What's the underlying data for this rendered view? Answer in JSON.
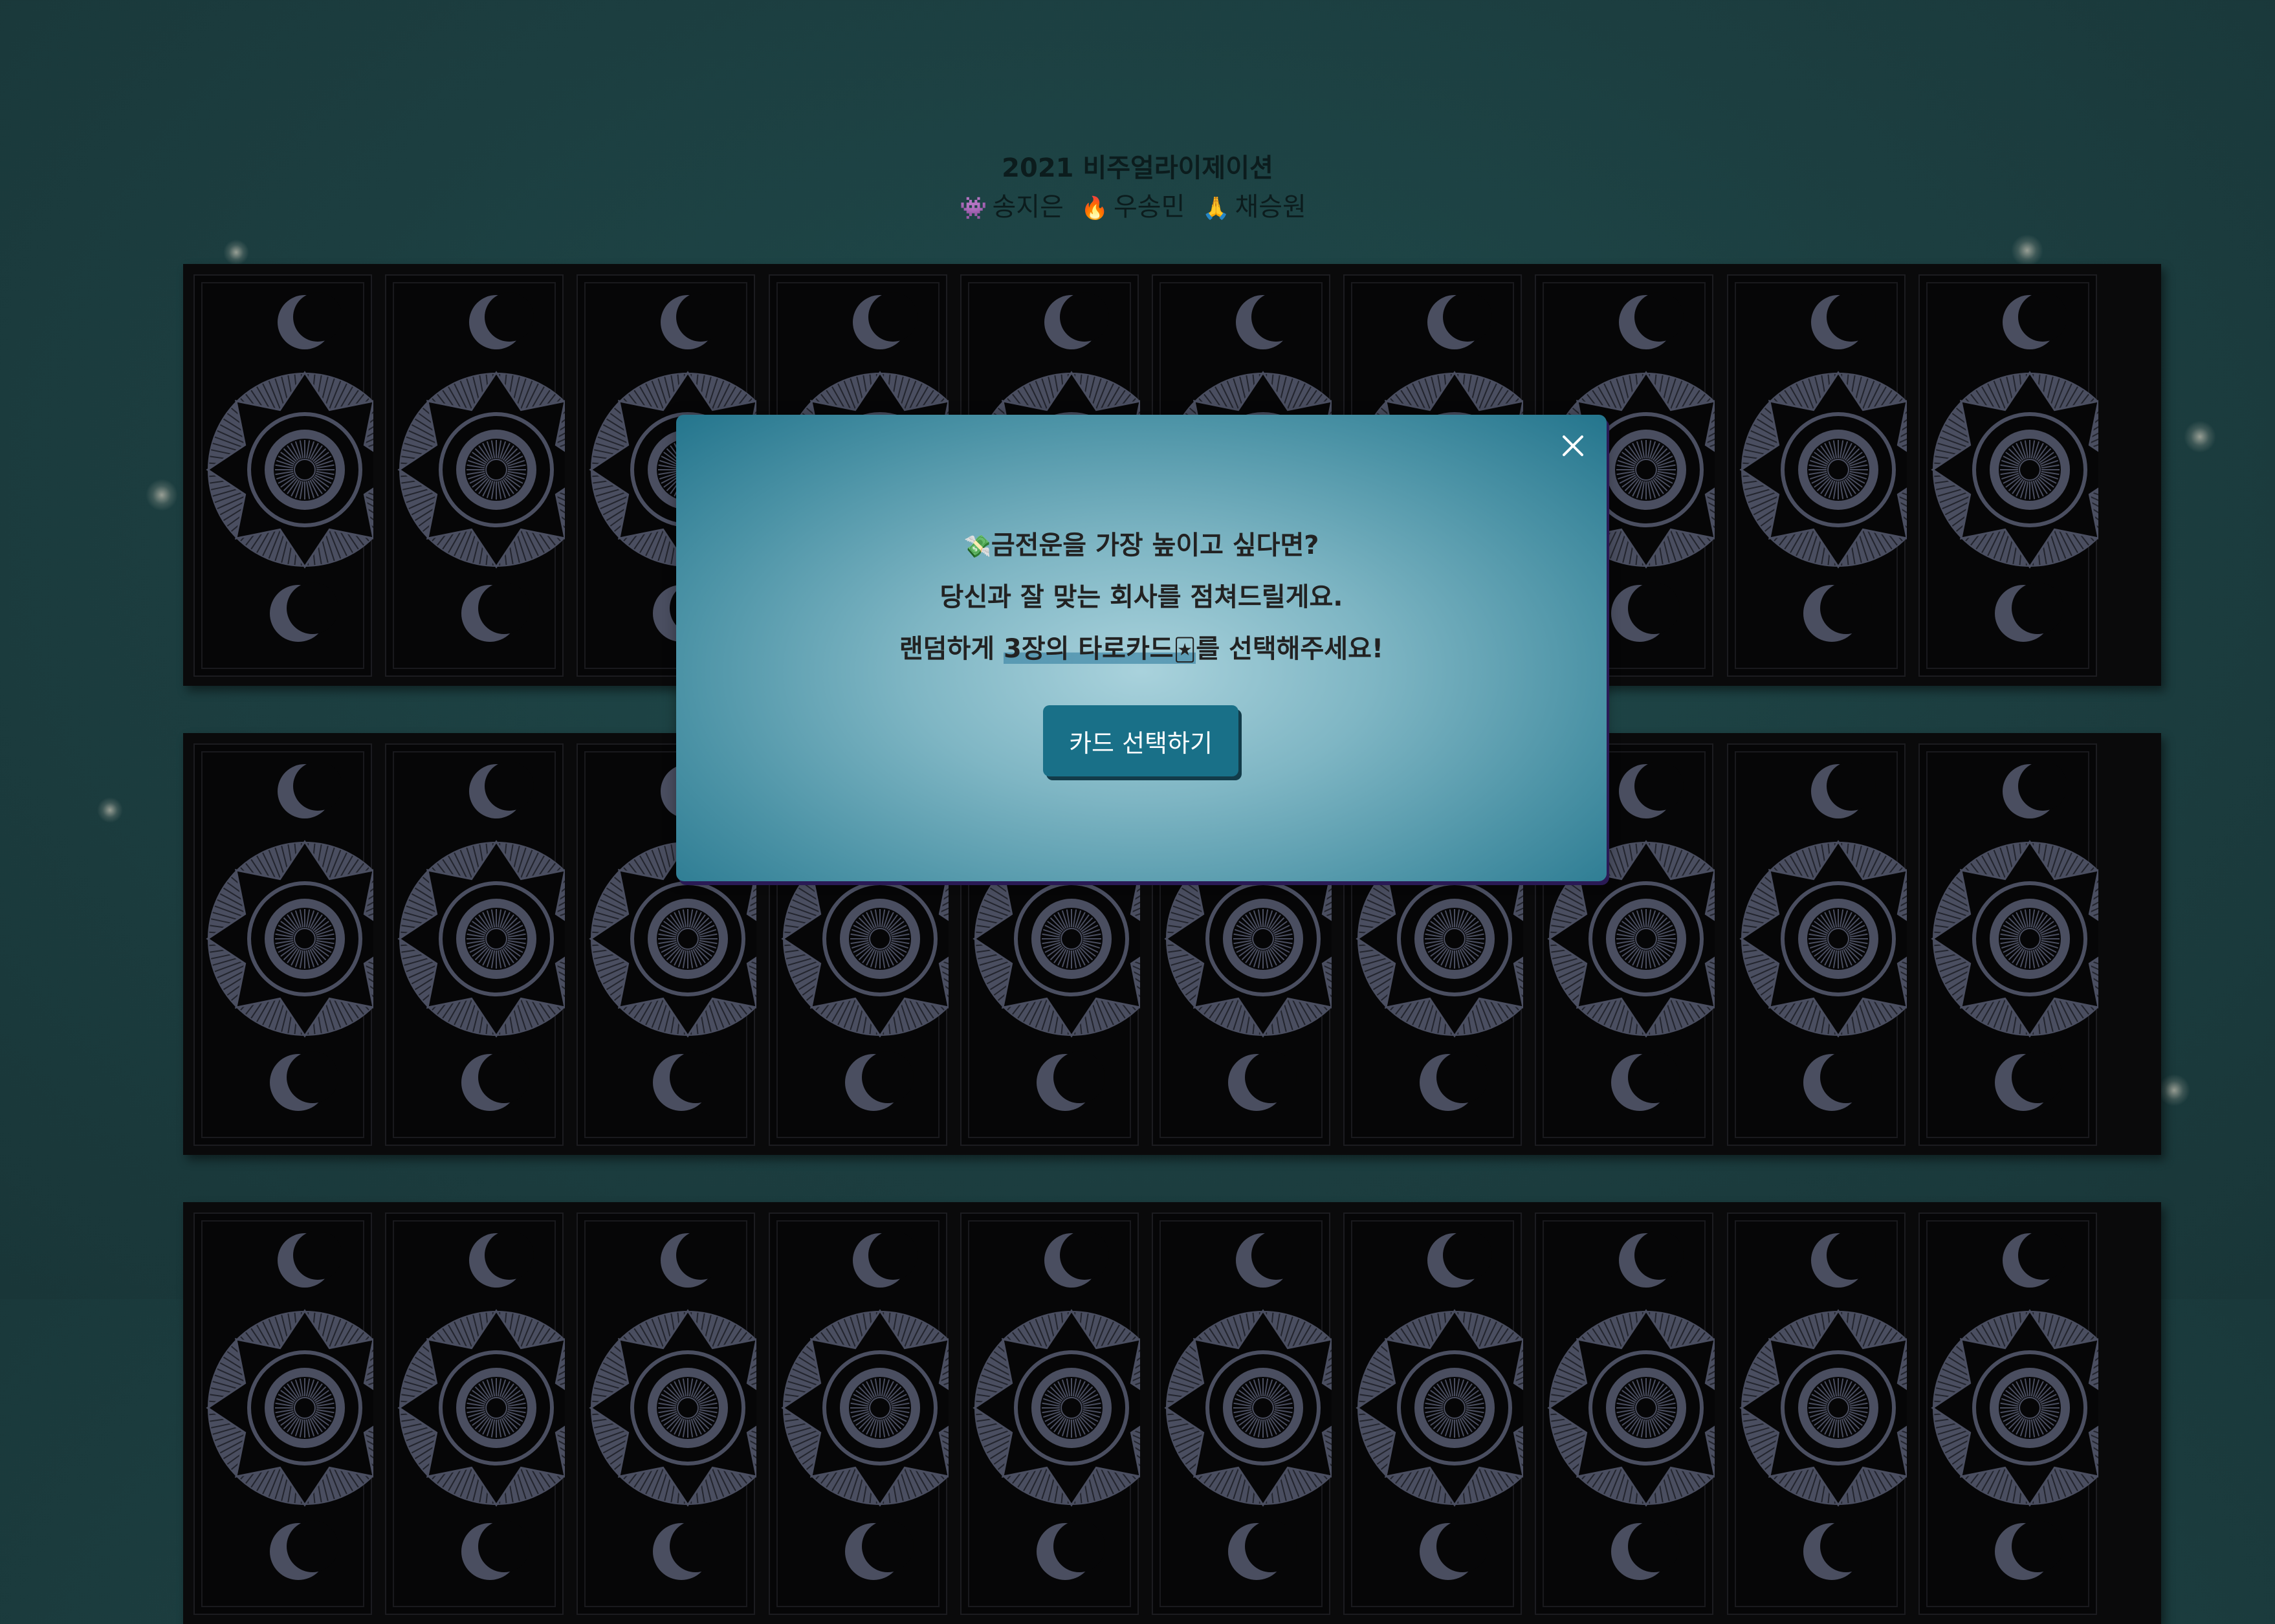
{
  "header": {
    "title": "2021 비주얼라이제이션",
    "credits": [
      {
        "icon": "👾",
        "icon_name": "alien-monster-icon",
        "name": "송지은"
      },
      {
        "icon": "🔥",
        "icon_name": "fire-icon",
        "name": "우송민"
      },
      {
        "icon": "🙏",
        "icon_name": "praying-hands-icon",
        "name": "채승원"
      }
    ]
  },
  "modal": {
    "line1_icon": "💸",
    "line1_icon_name": "money-with-wings-icon",
    "line1": "금전운을 가장 높이고 싶다면?",
    "line2": "당신과 잘 맞는 회사를 점쳐드릴게요.",
    "line3_before": "랜덤하게 ",
    "line3_highlight": "3장의 타로카드",
    "line3_icon": "🃏",
    "line3_icon_name": "tarot-card-icon",
    "line3_after": "를 선택해주세요!",
    "button_label": "카드 선택하기",
    "close_icon_name": "close-icon"
  },
  "cards": {
    "rows": 3,
    "cards_per_row": 10,
    "back_icon_name": "moon-sun-eye-icon"
  },
  "colors": {
    "background": "#1c3e40",
    "card_back": "#060607",
    "card_art": "#4a4e60",
    "modal_center": "#a9d2dc",
    "modal_edge": "#24758d",
    "button": "#197088"
  }
}
